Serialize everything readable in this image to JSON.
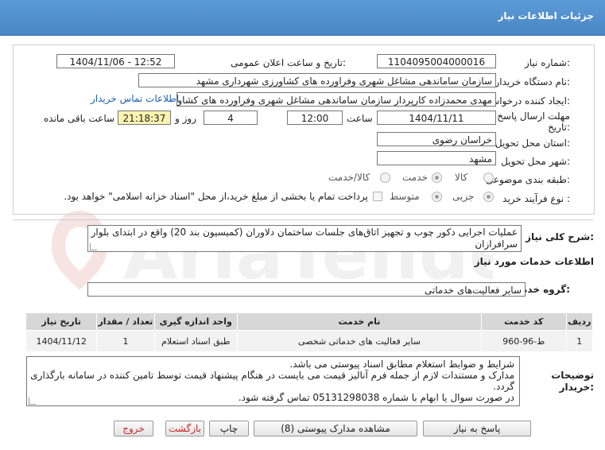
{
  "header": {
    "title": "جزئیات اطلاعات نیاز"
  },
  "form": {
    "need_number_label": "شماره نیاز:",
    "need_number": "1104095004000016",
    "announce_label": "تاریخ و ساعت اعلان عمومی:",
    "announce_value": "1404/11/06 - 12:52",
    "buyer_org_label": "نام دستگاه خریدار:",
    "buyer_org": "سازمان ساماندهی مشاغل شهری وفراورده های کشاورزی شهرداری مشهد",
    "creator_label": "ایجاد کننده درخواست:",
    "creator": "مهدی محمدزاده کارپرداز سازمان ساماندهی مشاغل شهری وفراورده های کشاورزی",
    "contact_link": "اطلاعات تماس خریدار",
    "deadline_label_1": "مهلت ارسال پاسخ: تا",
    "deadline_label_2": "تاریخ:",
    "deadline_date": "1404/11/11",
    "time_label": "ساعت",
    "deadline_time": "12:00",
    "days_value": "4",
    "days_label": "روز و",
    "remaining_time": "21:18:37",
    "remaining_label": "ساعت باقی مانده",
    "province_label": "استان محل تحویل:",
    "province": "خراسان رضوی",
    "city_label": "شهر محل تحویل:",
    "city": "مشهد",
    "category_label": "طبقه بندی موضوعی:",
    "category_options": [
      "کالا",
      "خدمت",
      "کالا/خدمت"
    ],
    "category_selected": "خدمت",
    "process_label": "نوع فرآیند خرید :",
    "process_options": [
      "جزیی",
      "متوسط"
    ],
    "process_selected": "جزیی",
    "payment_note": "پرداخت تمام یا بخشی از مبلغ خرید،از محل \"اسناد خزانه اسلامی\" خواهد بود."
  },
  "summary": {
    "label": "شرح کلی نیاز:",
    "text_line1": "عملیات اجرایی دکور چوب و تجهیز اتاق‌های جلسات ساختمان دلاوران (کمیسیون بند 20) واقع در ابتدای بلوار",
    "text_line2": "سرافرازان"
  },
  "services": {
    "section_title": "اطلاعات خدمات مورد نیاز",
    "group_label": "گروه خدمت:",
    "group_value": "سایر فعالیت‌های خدماتی",
    "columns": [
      "ردیف",
      "کد خدمت",
      "نام خدمت",
      "واحد اندازه گیری",
      "تعداد / مقدار",
      "تاریخ نیاز"
    ],
    "rows": [
      {
        "row": "1",
        "code": "ط-96-960",
        "name": "سایر فعالیت های خدماتی شخصی",
        "unit": "طبق اسناد استعلام",
        "qty": "1",
        "date": "1404/11/12"
      }
    ]
  },
  "notes": {
    "label_1": "توضیحات",
    "label_2": "خریدار:",
    "line1": "شرایط و ضوابط استعلام مطابق اسناد پیوستی می باشد.",
    "line2": "مدارک و مستندات لازم از جمله فرم آنالیز قیمت می بایست در هنگام پیشنهاد قیمت توسط تامین کننده در سامانه بارگذاری",
    "line3": "گردد.",
    "line4": "در صورت سوال یا ابهام با شماره 05131298038 تماس گرفته شود."
  },
  "footer": {
    "reply": "پاسخ به نیاز",
    "attachments": "مشاهده مدارک پیوستی (8)",
    "print": "چاپ",
    "back": "بازگشت",
    "exit": "خروج"
  },
  "watermark": {
    "text": "AriaTender.net"
  }
}
